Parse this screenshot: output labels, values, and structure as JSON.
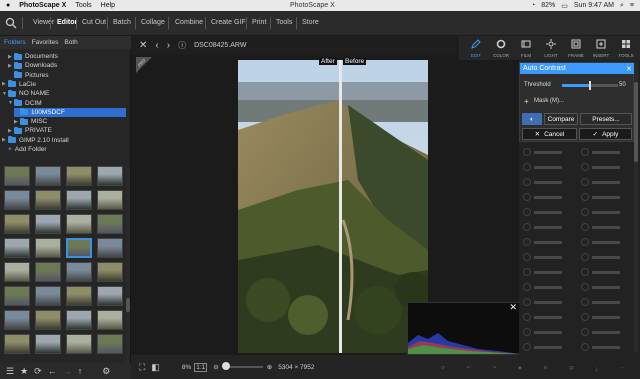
{
  "menubar": {
    "app_name": "PhotoScape X",
    "menu_tools": "Tools",
    "menu_help": "Help",
    "window_title": "PhotoScape X",
    "battery": "82%",
    "clock": "Sun 9:47 AM"
  },
  "tabs": [
    "Viewer",
    "Editor",
    "Cut Out",
    "Batch",
    "Collage",
    "Combine",
    "Create GIF",
    "Print",
    "Tools",
    "Store"
  ],
  "active_tab": "Editor",
  "sidebar": {
    "folder_tabs": [
      "Folders",
      "Favorites",
      "Both"
    ],
    "tree": [
      {
        "label": "Documents",
        "indent": 1,
        "arrow": "▶"
      },
      {
        "label": "Downloads",
        "indent": 1,
        "arrow": "▶"
      },
      {
        "label": "Pictures",
        "indent": 1,
        "arrow": ""
      },
      {
        "label": "LaCie",
        "indent": 0,
        "arrow": "▶"
      },
      {
        "label": "NO NAME",
        "indent": 0,
        "arrow": "▼"
      },
      {
        "label": "DCIM",
        "indent": 1,
        "arrow": "▼"
      },
      {
        "label": "100MSDCF",
        "indent": 2,
        "arrow": "",
        "selected": true
      },
      {
        "label": "MISC",
        "indent": 2,
        "arrow": "▶"
      },
      {
        "label": "PRIVATE",
        "indent": 1,
        "arrow": "▶"
      },
      {
        "label": "GIMP 2.10 Install",
        "indent": 0,
        "arrow": "▶"
      }
    ],
    "add_folder": "Add Folder"
  },
  "viewer": {
    "filename": "DSC08425.ARW",
    "after_label": "After",
    "before_label": "Before",
    "zoom": "8%",
    "ratio": "1:1",
    "dimensions": "5304 × 7952",
    "zoom_fraction": 0.08
  },
  "toolbar_right": [
    {
      "label": "EDIT",
      "icon": "pencil-icon"
    },
    {
      "label": "COLOR",
      "icon": "color-circle-icon"
    },
    {
      "label": "FILM",
      "icon": "film-icon"
    },
    {
      "label": "LIGHT",
      "icon": "sun-icon"
    },
    {
      "label": "FRAME",
      "icon": "frame-icon"
    },
    {
      "label": "INSERT",
      "icon": "insert-icon"
    },
    {
      "label": "TOOLS",
      "icon": "tools-icon"
    }
  ],
  "auto_contrast": {
    "title": "Auto Contrast",
    "threshold_label": "Threshold",
    "threshold_value": "50",
    "threshold_fraction": 0.5,
    "mask_label": "Mask (M)...",
    "compare_label": "Compare",
    "presets_label": "Presets...",
    "cancel_label": "Cancel",
    "apply_label": "Apply"
  },
  "colors": {
    "accent": "#3d9bff",
    "panel_bg": "#262626"
  }
}
